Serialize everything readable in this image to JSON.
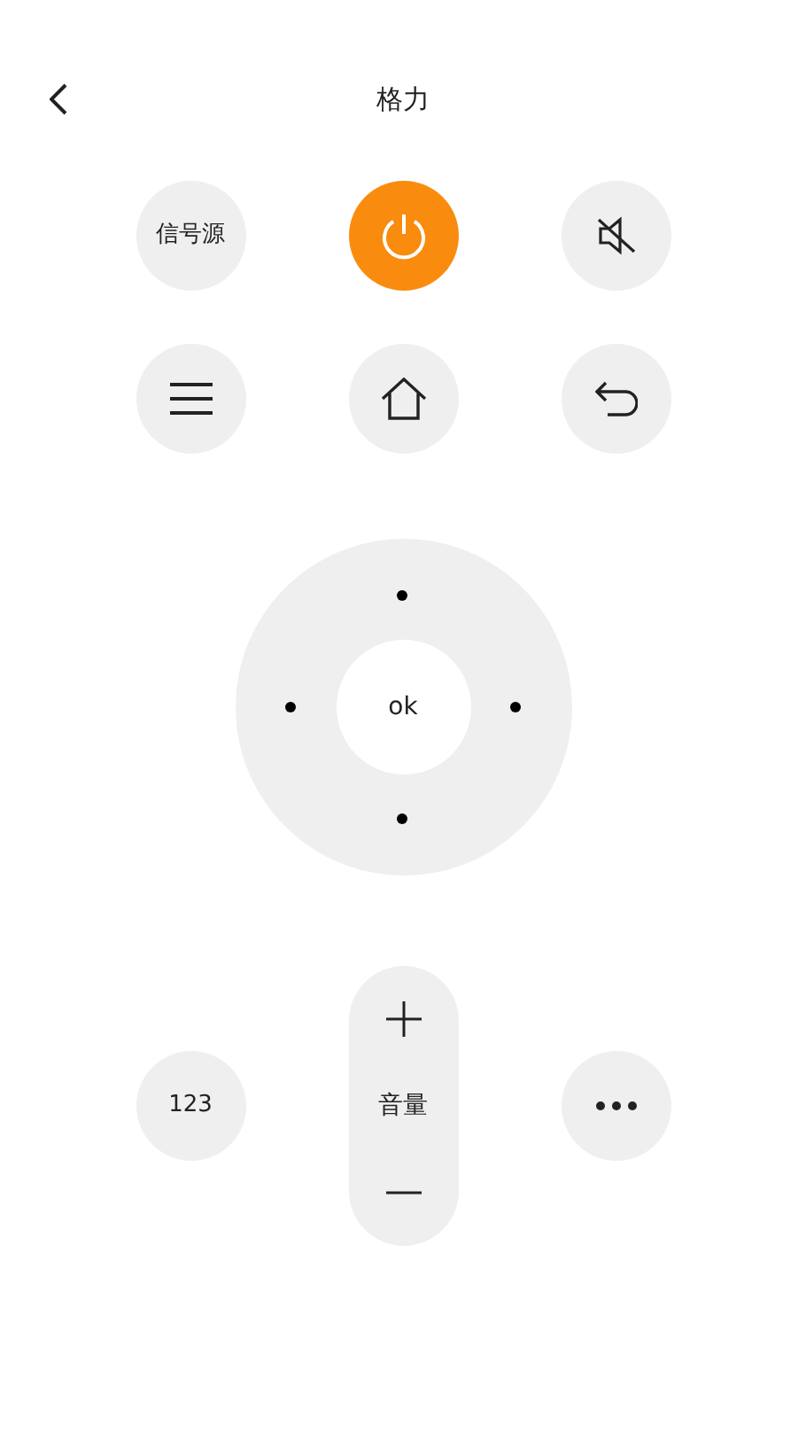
{
  "header": {
    "title": "格力"
  },
  "top_row": {
    "source_label": "信号源"
  },
  "dpad": {
    "ok_label": "ok"
  },
  "bottom_row": {
    "numbers_label": "123",
    "volume_label": "音量"
  }
}
